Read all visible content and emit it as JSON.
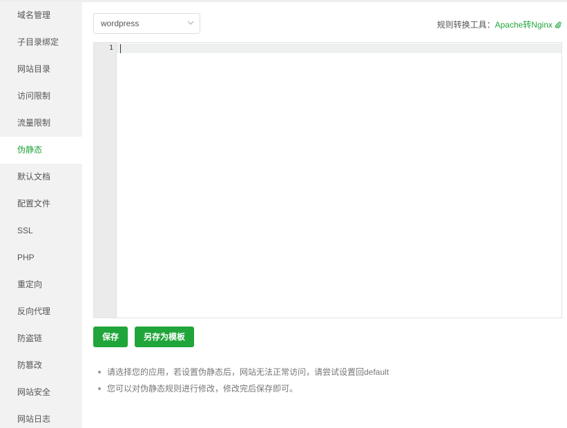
{
  "sidebar": {
    "items": [
      {
        "label": "域名管理",
        "active": false
      },
      {
        "label": "子目录绑定",
        "active": false
      },
      {
        "label": "网站目录",
        "active": false
      },
      {
        "label": "访问限制",
        "active": false
      },
      {
        "label": "流量限制",
        "active": false
      },
      {
        "label": "伪静态",
        "active": true
      },
      {
        "label": "默认文档",
        "active": false
      },
      {
        "label": "配置文件",
        "active": false
      },
      {
        "label": "SSL",
        "active": false
      },
      {
        "label": "PHP",
        "active": false
      },
      {
        "label": "重定向",
        "active": false
      },
      {
        "label": "反向代理",
        "active": false
      },
      {
        "label": "防盗链",
        "active": false
      },
      {
        "label": "防篡改",
        "active": false
      },
      {
        "label": "网站安全",
        "active": false
      },
      {
        "label": "网站日志",
        "active": false
      }
    ]
  },
  "rewrite": {
    "template_select": {
      "value": "wordpress"
    },
    "tool_label": "规则转换工具：",
    "tool_link": "Apache转Nginx",
    "editor": {
      "line_number": "1",
      "content": ""
    },
    "save_label": "保存",
    "save_as_template_label": "另存为模板",
    "tips": [
      "请选择您的应用，若设置伪静态后，网站无法正常访问，请尝试设置回default",
      "您可以对伪静态规则进行修改，修改完后保存即可。"
    ]
  },
  "colors": {
    "accent": "#20a53a",
    "sidebar_bg": "#f2f2f2"
  },
  "icons": {
    "select_arrow": "chevron-down-icon",
    "link_icon": "paperclip-icon"
  }
}
